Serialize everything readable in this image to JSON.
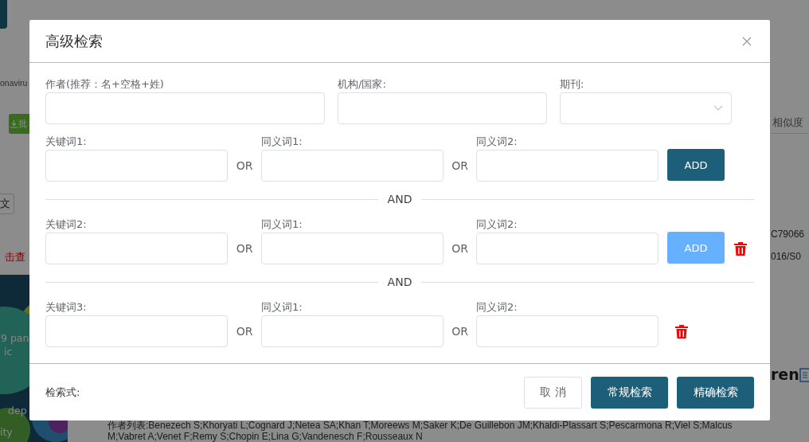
{
  "background": {
    "search_term": "onaviru",
    "export_button": "批",
    "filter_box": "文",
    "notice_link": "击查",
    "sort_label": "相似度",
    "id_fragment": "C79066",
    "doi_fragment": "016/S0",
    "title_fragment": "ren",
    "bubble_labels": [
      "9 pan",
      "ic",
      "dep",
      "ity"
    ],
    "author_lines": [
      "作者列表:Benezech S;Khoryati L;Cognard J;Netea SA;Khan T;Moreews M;Saker K;De Guillebon JM;Khaldi-Plassart S;Pescarmona R;Viel S;Malcus",
      "M;Vabret A;Venet F;Remy S;Chopin E;Lina G;Vandenesch F;Rousseaux N"
    ]
  },
  "dialog": {
    "title": "高级检索",
    "fields": [
      {
        "kind": "text",
        "label": "作者(推荐：名+空格+姓)"
      },
      {
        "kind": "text",
        "label": "机构/国家:"
      },
      {
        "kind": "select",
        "label": "期刊:"
      }
    ],
    "keyword_rows": [
      {
        "labels": [
          "关键词1:",
          "同义词1:",
          "同义词2:"
        ],
        "or_labels": [
          "OR",
          "OR"
        ],
        "add_button": {
          "label": "ADD",
          "disabled": false
        },
        "deletable": false
      },
      {
        "labels": [
          "关键词2:",
          "同义词1:",
          "同义词2:"
        ],
        "or_labels": [
          "OR",
          "OR"
        ],
        "add_button": {
          "label": "ADD",
          "disabled": true
        },
        "deletable": true
      },
      {
        "labels": [
          "关键词3:",
          "同义词1:",
          "同义词2:"
        ],
        "or_labels": [
          "OR",
          "OR"
        ],
        "deletable": true
      }
    ],
    "connectors": [
      "AND",
      "AND"
    ],
    "footer": {
      "query_label": "检索式:",
      "buttons": [
        {
          "kind": "plain",
          "label": "取 消"
        },
        {
          "kind": "primary",
          "label": "常规检索"
        },
        {
          "kind": "primary",
          "label": "精确检索"
        }
      ]
    }
  }
}
